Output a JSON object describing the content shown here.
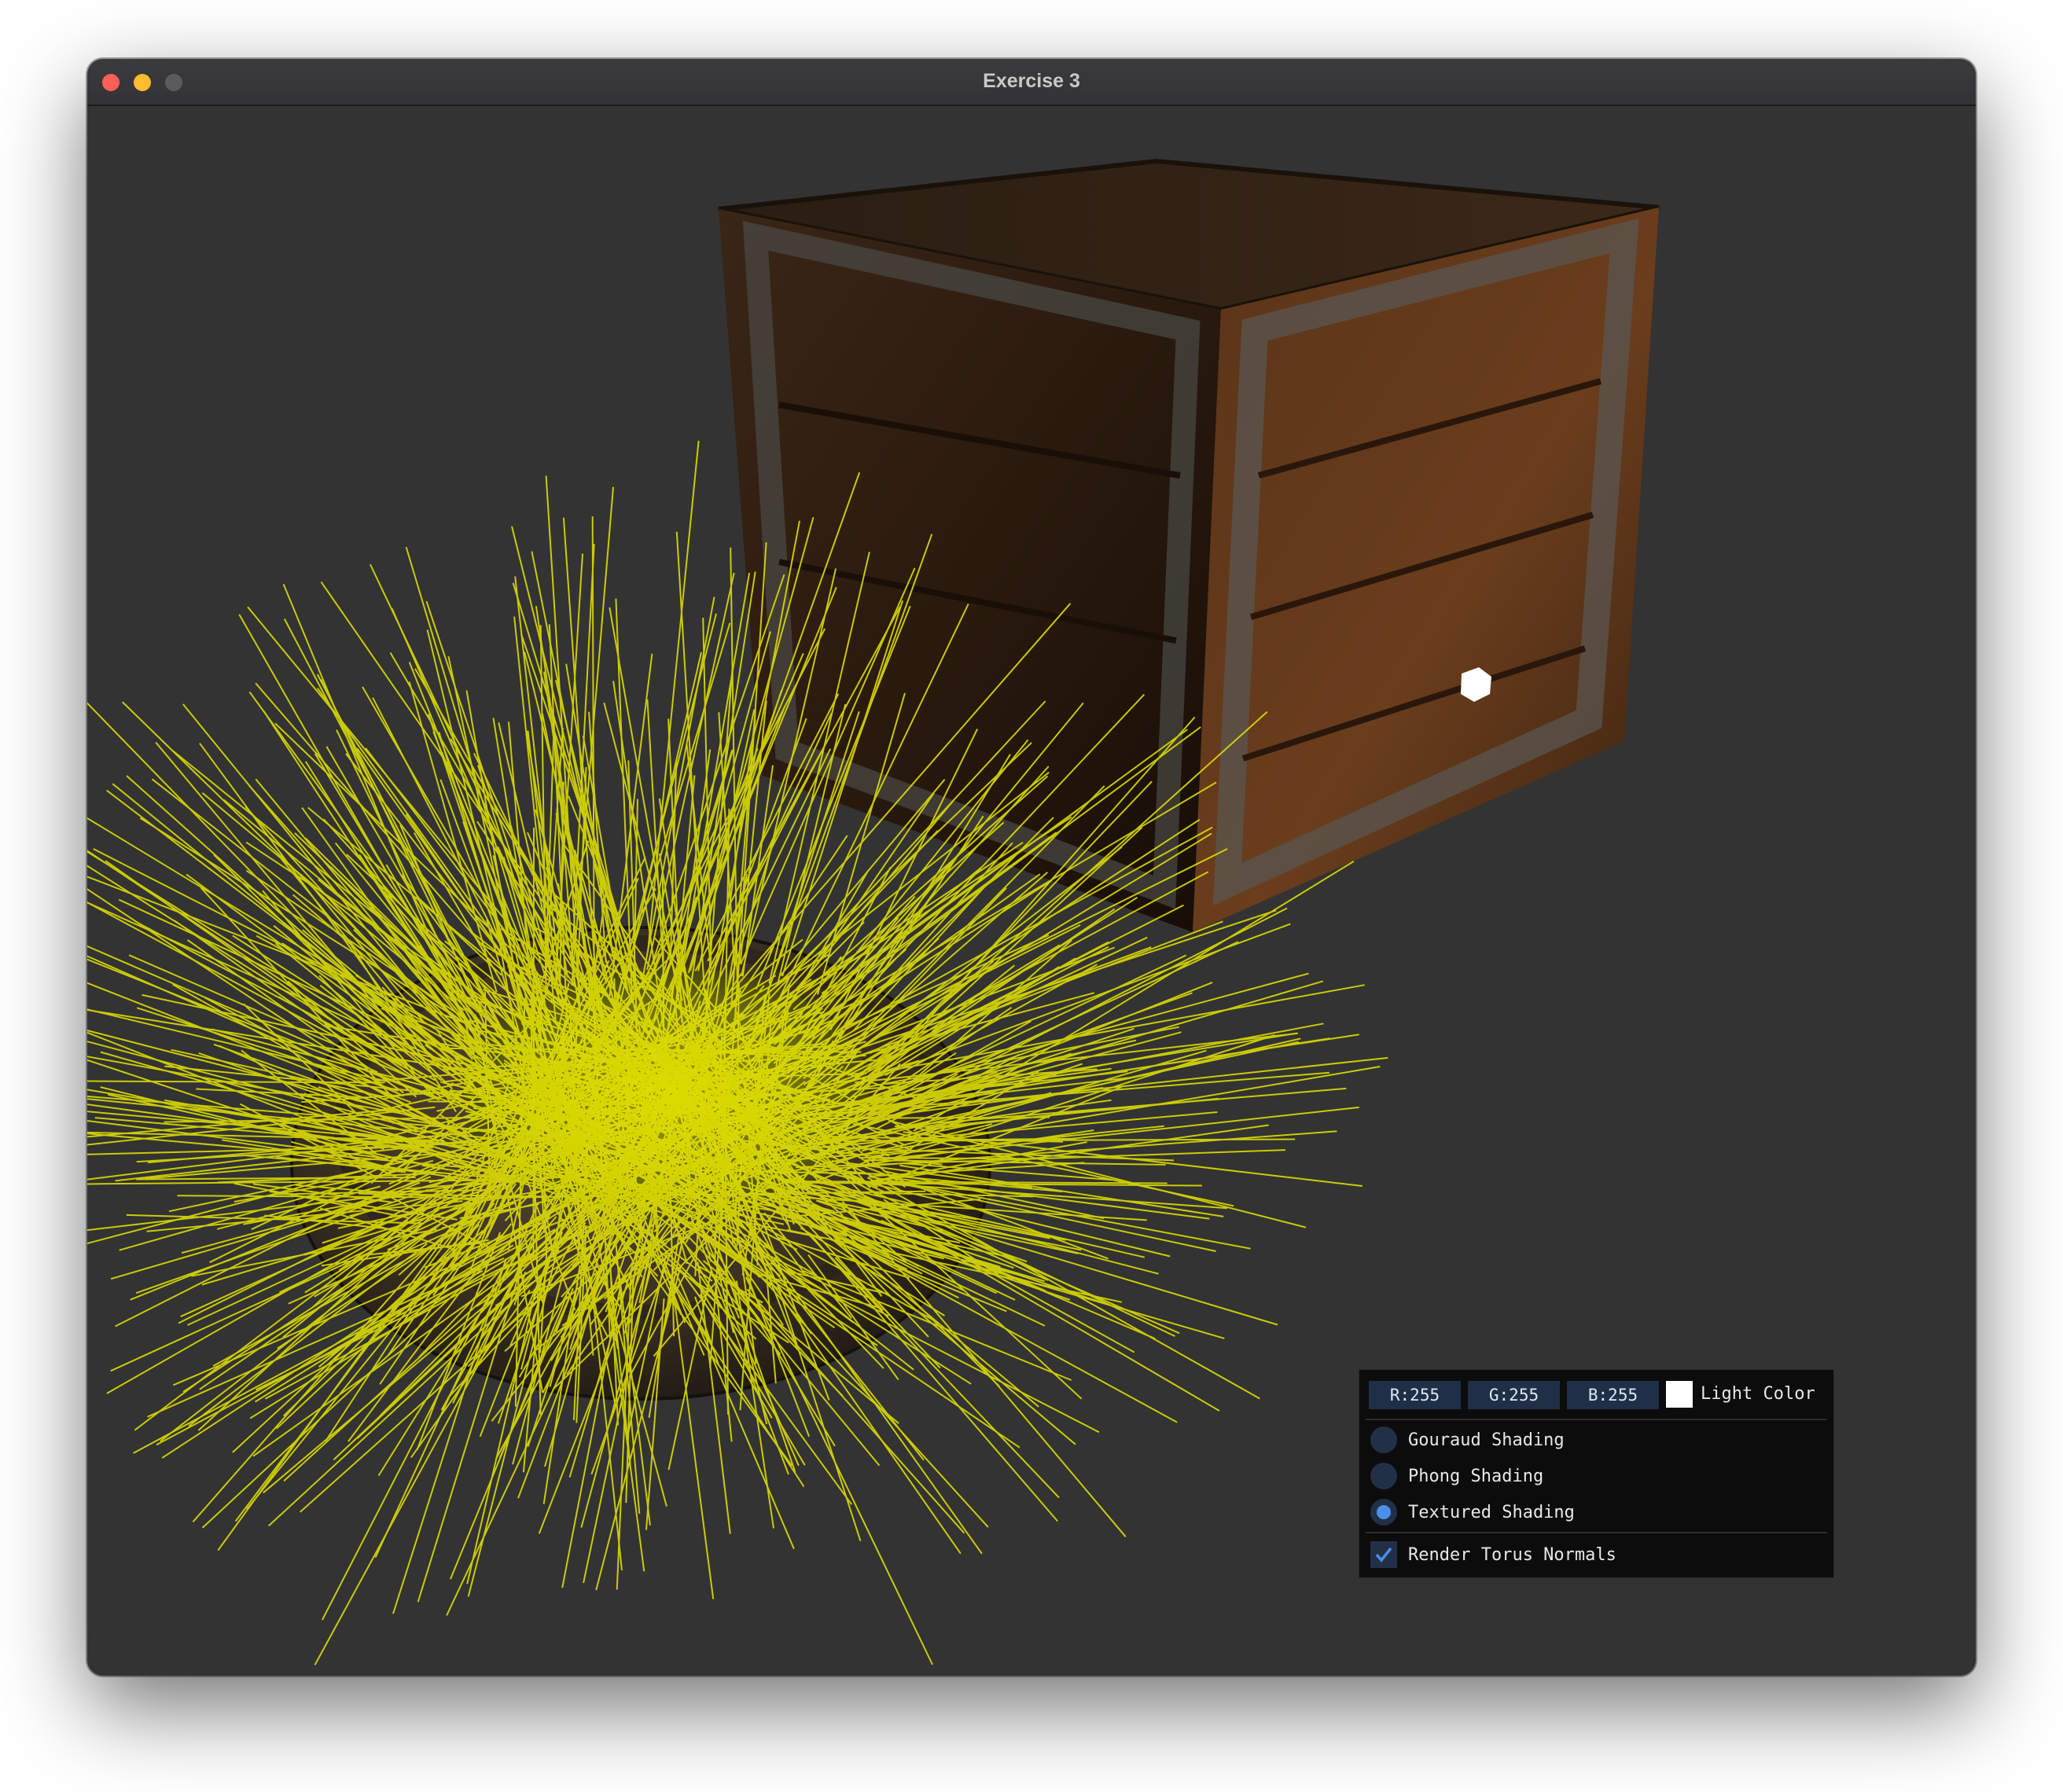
{
  "window": {
    "title": "Exercise 3"
  },
  "panel": {
    "light_color": {
      "r_label": "R:255",
      "g_label": "G:255",
      "b_label": "B:255",
      "label": "Light Color",
      "swatch_color": "#ffffff"
    },
    "shading_options": [
      {
        "label": "Gouraud Shading",
        "selected": false
      },
      {
        "label": "Phong Shading",
        "selected": false
      },
      {
        "label": "Textured Shading",
        "selected": true
      }
    ],
    "render_normals": {
      "label": "Render Torus Normals",
      "checked": true
    }
  },
  "colors": {
    "viewport_background": "#333333",
    "normals": "#e6e600",
    "accent": "#4a8fe8",
    "widget_frame": "#223047"
  },
  "icons": [
    "crate-object",
    "torus-object",
    "light-source-cube",
    "checkmark-icon"
  ]
}
